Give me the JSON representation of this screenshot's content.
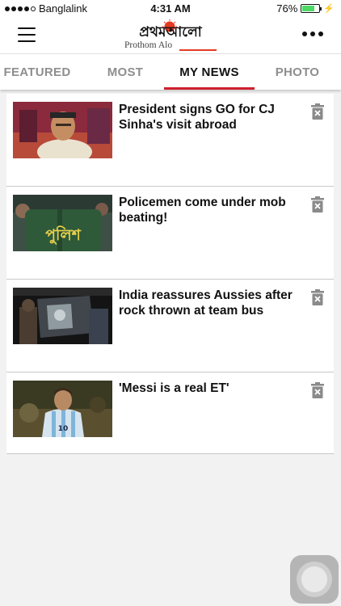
{
  "status_bar": {
    "carrier": "Banglalink",
    "time": "4:31 AM",
    "battery": "76%",
    "battery_level": 0.76
  },
  "header": {
    "logo_bangla": "প্রথমআলো",
    "logo_english": "Prothom Alo",
    "menu_icon": "hamburger-menu-icon",
    "more_icon": "more-dots-icon"
  },
  "tabs": [
    {
      "label": "FEATURED",
      "active": false
    },
    {
      "label": "MOST",
      "active": false
    },
    {
      "label": "MY NEWS",
      "active": true
    },
    {
      "label": "PHOTO",
      "active": false
    }
  ],
  "articles": [
    {
      "title": "President signs GO for CJ Sinha's visit abroad",
      "thumb": "president"
    },
    {
      "title": "Policemen come under mob beating!",
      "thumb": "police",
      "thumb_text": "পুলিশ"
    },
    {
      "title": "India reassures Aussies after rock thrown at team bus",
      "thumb": "bus"
    },
    {
      "title": "'Messi is a real ET'",
      "thumb": "messi",
      "thumb_text": "10"
    }
  ],
  "colors": {
    "accent": "#d0202e",
    "inactive_tab": "#8e8e8e",
    "background": "#f2f2f2"
  }
}
